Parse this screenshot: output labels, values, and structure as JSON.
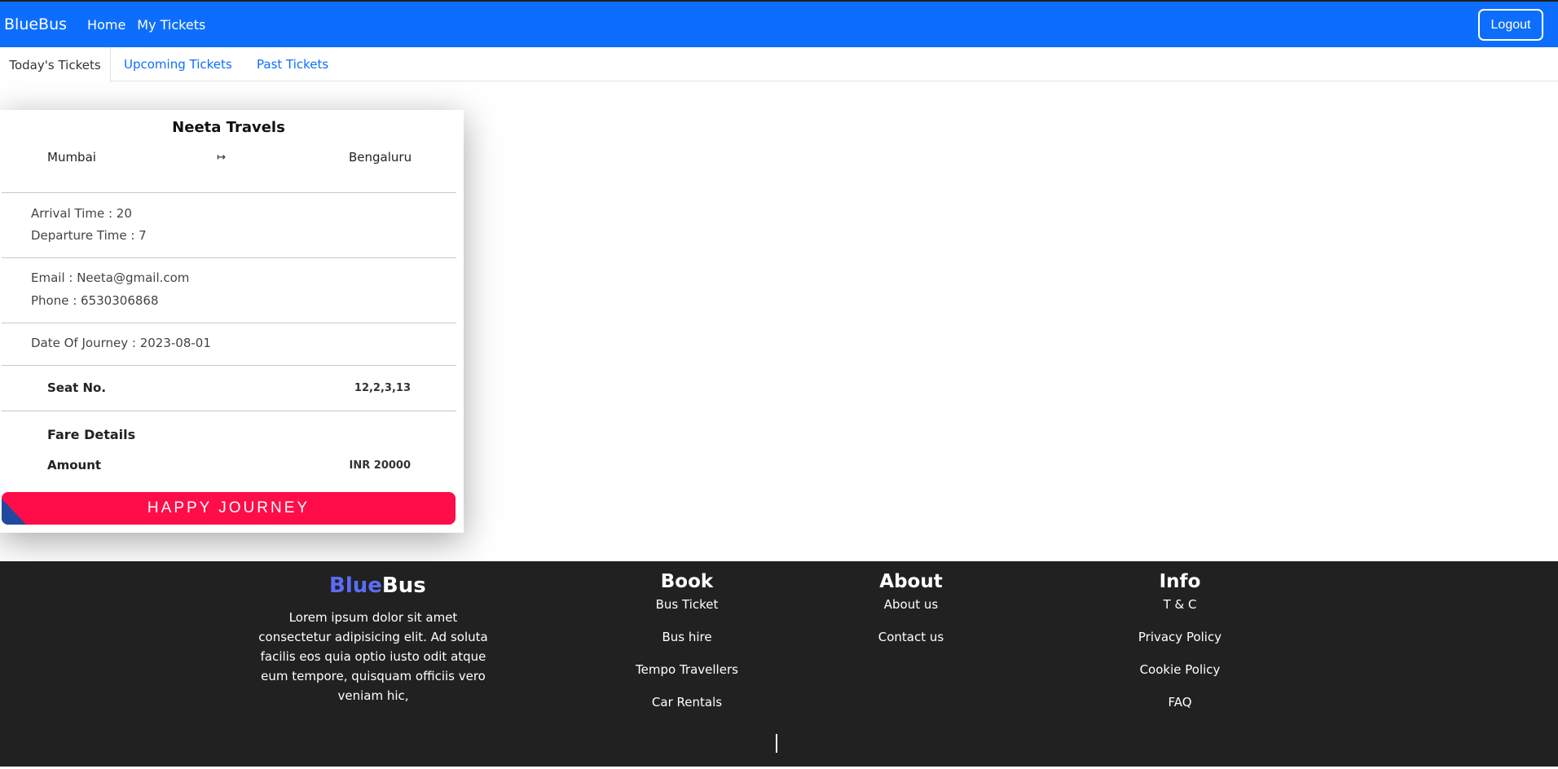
{
  "nav": {
    "brand": "BlueBus",
    "links": [
      "Home",
      "My Tickets"
    ],
    "logout": "Logout",
    "color": "#0d6efd"
  },
  "tabs": [
    "Today's Tickets",
    "Upcoming Tickets",
    "Past Tickets"
  ],
  "ticket": {
    "operator": "Neeta Travels",
    "from": "Mumbai",
    "arrow_icon": "↦",
    "to": "Bengaluru",
    "arrival": "Arrival Time : 20",
    "departure": "Departure Time : 7",
    "email": "Email : Neeta@gmail.com",
    "phone": "Phone : 6530306868",
    "date": "Date Of Journey : 2023-08-01",
    "seat_label": "Seat No.",
    "seat_value": "12,2,3,13",
    "fare_title": "Fare Details",
    "amount_label": "Amount",
    "amount_value": "INR 20000",
    "banner": "HAPPY JOURNEY",
    "banner_color": "#ff0d48"
  },
  "footer": {
    "brand_blue": "Blue",
    "brand_rest": "Bus",
    "text": "Lorem ipsum dolor sit amet consectetur adipisicing elit. Ad soluta facilis eos quia optio iusto odit atque eum tempore, quisquam officiis vero veniam hic,",
    "book": {
      "title": "Book",
      "links": [
        "Bus Ticket",
        "Bus hire",
        "Tempo Travellers",
        "Car Rentals"
      ]
    },
    "about": {
      "title": "About",
      "links": [
        "About us",
        "Contact us"
      ]
    },
    "info": {
      "title": "Info",
      "links": [
        "T & C",
        "Privacy Policy",
        "Cookie Policy",
        "FAQ"
      ]
    },
    "background": "#212121"
  }
}
